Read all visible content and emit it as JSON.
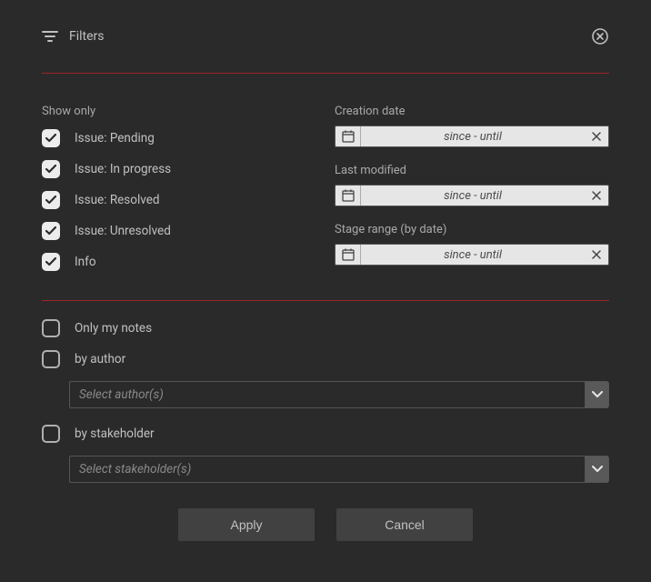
{
  "header": {
    "title": "Filters"
  },
  "show_only": {
    "label": "Show only",
    "items": [
      {
        "label": "Issue: Pending",
        "checked": true
      },
      {
        "label": "Issue: In progress",
        "checked": true
      },
      {
        "label": "Issue: Resolved",
        "checked": true
      },
      {
        "label": "Issue: Unresolved",
        "checked": true
      },
      {
        "label": "Info",
        "checked": true
      }
    ]
  },
  "date_filters": [
    {
      "label": "Creation date",
      "placeholder": "since - until"
    },
    {
      "label": "Last modified",
      "placeholder": "since - until"
    },
    {
      "label": "Stage range (by date)",
      "placeholder": "since - until"
    }
  ],
  "lower": {
    "only_my_notes": {
      "label": "Only my notes",
      "checked": false
    },
    "by_author": {
      "label": "by author",
      "checked": false,
      "placeholder": "Select author(s)"
    },
    "by_stakeholder": {
      "label": "by stakeholder",
      "checked": false,
      "placeholder": "Select stakeholder(s)"
    }
  },
  "buttons": {
    "apply": "Apply",
    "cancel": "Cancel"
  }
}
